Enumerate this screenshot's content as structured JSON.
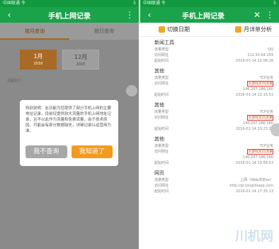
{
  "left": {
    "status": {
      "carrier": "中国联通 令",
      "time": "5"
    },
    "nav": {
      "back": "‹",
      "title": "手机上网记录",
      "more": "⋮"
    },
    "tabs": [
      "按月查询",
      "按日查询"
    ],
    "months": [
      {
        "label": "1月",
        "year": "2016"
      },
      {
        "label": "12月",
        "year": "2015"
      }
    ],
    "hint": "温馨提示：",
    "dialog": {
      "text": "特别说明：此功能为您提供了部分手机上网的主要地址记录，目前仅提供较大流量的手机上网地址记录，且不以此作为流量和免费流量，由于技术原因，可能会有部分数据缺失，详细记录以运营商为准。",
      "cancel": "我不查询",
      "confirm": "我知道了"
    }
  },
  "right": {
    "status": {
      "carrier": "中国联通 令",
      "time": "5"
    },
    "nav": {
      "back": "‹",
      "title": "手机上网记录",
      "close": "✕",
      "more": "⋮"
    },
    "toolbar": {
      "date": "切换日期",
      "analysis": "月详单分析"
    },
    "sections": [
      {
        "title": "新闻工具",
        "type_label": "流量类型",
        "type": "QQ",
        "addr_label": "访问网址",
        "addr": "112.50.64.159",
        "time_label": "起始时间",
        "time": "2016-01-14 22:08:16",
        "highlight": false
      },
      {
        "title": "其他",
        "type_label": "流量类型",
        "type": "TCP业务",
        "addr_label": "访问网址",
        "addr": "沃游戏定向流量",
        "addr2": "140.207.186.160",
        "time_label": "起始时间",
        "time": "2016-01-14 22:15:51",
        "highlight": true
      },
      {
        "title": "其他",
        "type_label": "流量类型",
        "type": "TCP业务",
        "addr_label": "访问网址",
        "addr": "沃游戏定向流量",
        "addr2": "140.207.186.160",
        "time_label": "起始时间",
        "time": "2016-01-14 20:23:25",
        "highlight": true
      },
      {
        "title": "其他",
        "type_label": "流量类型",
        "type": "TCP业务",
        "addr_label": "访问网址",
        "addr": "沃游戏定向流量",
        "addr2": "140.207.186.160",
        "time_label": "起始时间",
        "time": "2016-01-14 19:59:53",
        "highlight": true
      },
      {
        "title": "网页",
        "type_label": "流量类型",
        "type": "上网（Web浏览ex）",
        "addr_label": "访问网址",
        "addr": "http://pl.tongshiapp.com",
        "time_label": "起始时间",
        "time": "2016-01-14 17:35:13",
        "highlight": false
      }
    ],
    "watermark": "川机网"
  }
}
